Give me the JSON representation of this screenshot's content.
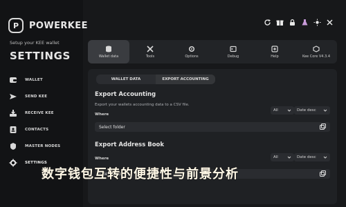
{
  "brand": {
    "name": "POWERKEE",
    "logo_letter": "P"
  },
  "sidebar": {
    "setup_text": "Setup your KEE wallet",
    "title": "SETTINGS",
    "items": [
      {
        "label": "WALLET",
        "icon": "wallet-icon"
      },
      {
        "label": "SEND KEE",
        "icon": "send-icon"
      },
      {
        "label": "RECEIVE KEE",
        "icon": "receive-icon"
      },
      {
        "label": "CONTACTS",
        "icon": "contacts-icon"
      },
      {
        "label": "MASTER NODES",
        "icon": "master-nodes-icon"
      },
      {
        "label": "SETTINGS",
        "icon": "settings-icon",
        "active": true
      }
    ]
  },
  "topbar": {
    "icons": [
      "refresh-icon",
      "gift-icon",
      "lock-icon",
      "flask-icon",
      "sun-icon",
      "close-icon"
    ]
  },
  "toolbar": {
    "items": [
      {
        "label": "Wallet data",
        "icon": "database-icon",
        "active": true
      },
      {
        "label": "Tools",
        "icon": "tools-icon"
      },
      {
        "label": "Options",
        "icon": "options-icon"
      },
      {
        "label": "Debug",
        "icon": "debug-icon"
      },
      {
        "label": "Help",
        "icon": "help-icon"
      },
      {
        "label": "Kee Core V4.3.4",
        "icon": "kee-core-icon"
      }
    ]
  },
  "main": {
    "tabs": [
      {
        "label": "WALLET DATA"
      },
      {
        "label": "EXPORT ACCOUNTING",
        "active": true
      }
    ],
    "export_accounting": {
      "title": "Export Accounting",
      "description": "Export your wallets accounting data to a CSV file.",
      "where_label": "Where",
      "select_folder": "Select folder",
      "filter": "All",
      "sort": "Date desc"
    },
    "export_address_book": {
      "title": "Export Address Book",
      "where_label": "Where",
      "filter": "All",
      "sort": "Date desc"
    }
  },
  "overlay_text": "数字钱包互转的便捷性与前景分析"
}
